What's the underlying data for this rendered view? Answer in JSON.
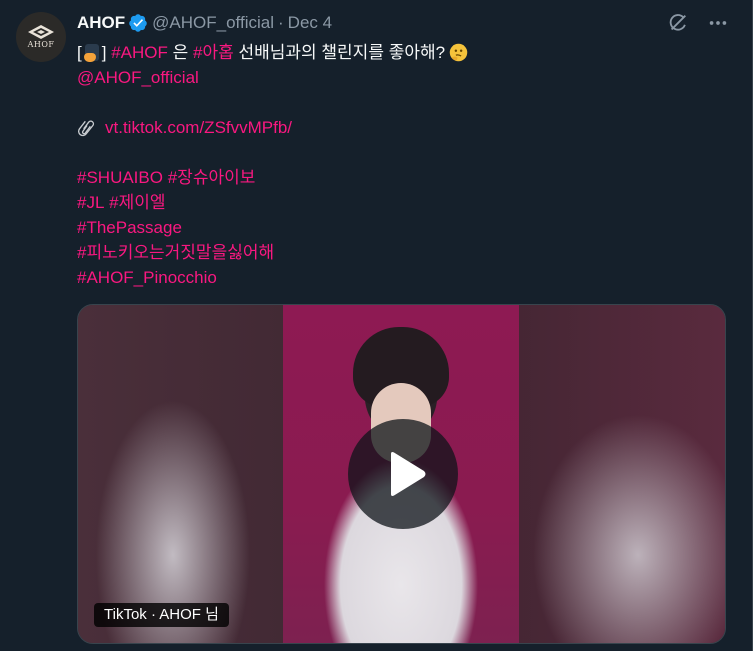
{
  "tweet": {
    "author": {
      "display_name": "AHOF",
      "handle": "@AHOF_official",
      "avatar_text": "AHOF"
    },
    "separator": "·",
    "date": "Dec 4",
    "body": {
      "line1": {
        "bracket_open": "[",
        "bracket_close": "]",
        "tag_ahof": "#AHOF",
        "particle": "은",
        "tag_ahop": "#아홉",
        "rest": "선배님과의 챌린지를 좋아해?"
      },
      "mention": "@AHOF_official",
      "url": "vt.tiktok.com/ZSfvvMPfb/",
      "hashtags_line1": [
        "#SHUAIBO",
        "#장슈아이보"
      ],
      "hashtags_line2": [
        "#JL",
        "#제이엘"
      ],
      "hashtags_line3": "#ThePassage",
      "hashtags_line4": "#피노키오는거짓말을싫어해",
      "hashtags_line5": "#AHOF_Pinocchio"
    },
    "media": {
      "badge": "TikTok · AHOF 님"
    }
  },
  "icons": {
    "verified": "verified-badge-icon",
    "grok": "grok-icon",
    "more": "more-icon",
    "link": "paperclip-icon",
    "play": "play-icon"
  },
  "colors": {
    "background": "#15202b",
    "link": "#f91880",
    "verified": "#1d9bf0",
    "secondary_text": "#8b98a5"
  }
}
